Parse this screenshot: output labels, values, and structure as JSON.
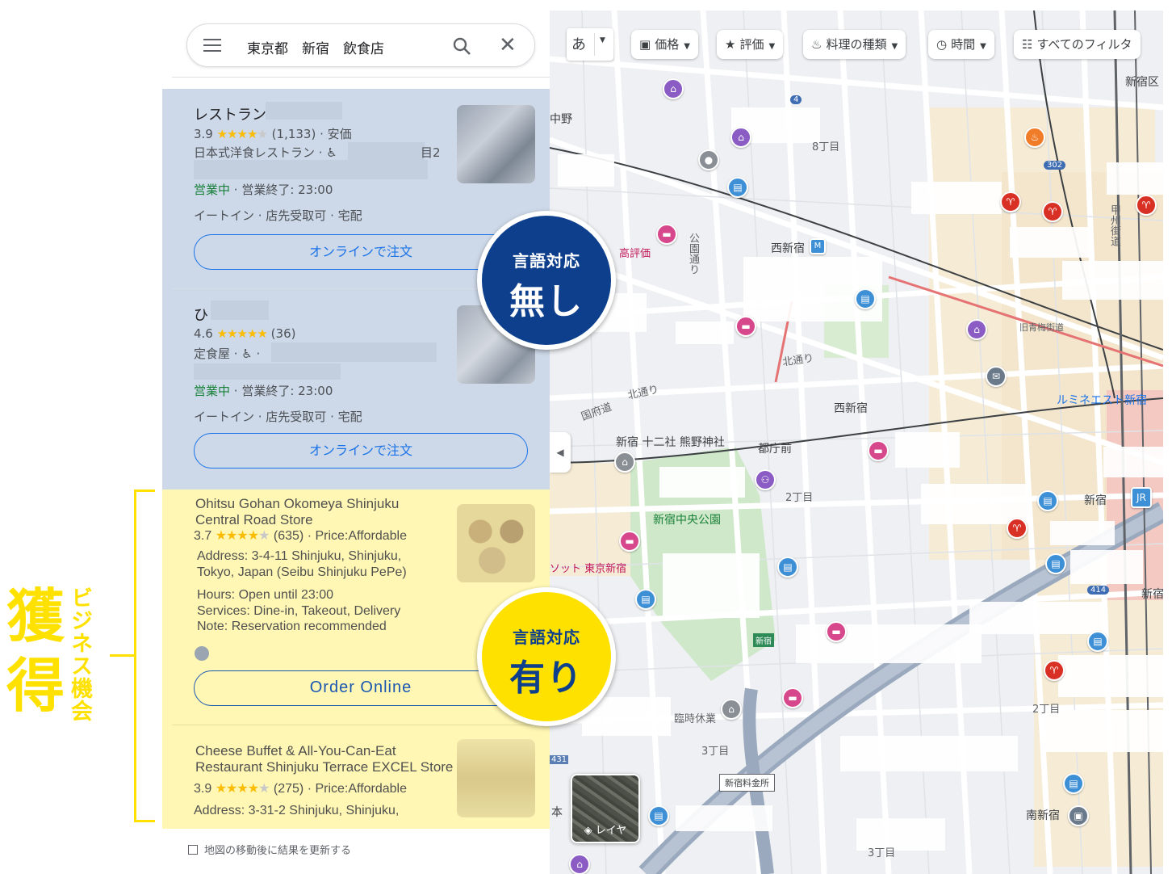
{
  "annotation": {
    "big_label": "獲得",
    "vertical_label": "ビジネス機会"
  },
  "search": {
    "query": "東京都　新宿　飲食店",
    "menu_icon": "hamburger-menu-icon",
    "search_icon": "magnifier-icon",
    "clear_icon": "close-icon"
  },
  "results_untranslated": [
    {
      "name": "レストラン",
      "rating": "3.9",
      "stars": "★★★★",
      "star_empty": "★",
      "reviews": "(1,133)",
      "price": "· 安価",
      "category": "日本式洋食レストラン · ♿",
      "address_tail": "目2",
      "status_open": "営業中",
      "status_rest": " · 営業終了: 23:00",
      "services": "イートイン · 店先受取可 · 宅配",
      "button": "オンラインで注文"
    },
    {
      "name": "ひ",
      "rating": "4.6",
      "stars": "★★★★★",
      "star_empty": "",
      "reviews": "(36)",
      "price": "",
      "category": "定食屋 · ♿ ·",
      "address_tail": "",
      "status_open": "営業中",
      "status_rest": " · 営業終了: 23:00",
      "services": "イートイン · 店先受取可 · 宅配",
      "button": "オンラインで注文"
    }
  ],
  "results_translated": [
    {
      "name_line1": "Ohitsu Gohan Okomeya Shinjuku",
      "name_line2": "Central Road Store",
      "rating": "3.7",
      "stars": "★★★★",
      "star_empty": "★",
      "reviews": "(635)",
      "price": "· Price:Affordable",
      "address_line1": "Address: 3-4-11 Shinjuku, Shinjuku,",
      "address_line2": "Tokyo, Japan (Seibu Shinjuku PePe)",
      "hours": "Hours: Open until 23:00",
      "services": "Services: Dine-in, Takeout, Delivery",
      "note": "Note: Reservation recommended",
      "button": "Order Online"
    },
    {
      "name_line1": "Cheese Buffet & All-You-Can-Eat",
      "name_line2": "Restaurant Shinjuku Terrace EXCEL Store",
      "rating": "3.9",
      "stars": "★★★★",
      "star_empty": "★",
      "reviews": "(275)",
      "price": "· Price:Affordable",
      "address_line1": "Address: 3-31-2 Shinjuku, Shinjuku,"
    }
  ],
  "footer": {
    "checkbox_label": "地図の移動後に結果を更新する"
  },
  "map": {
    "lang_chip": "あ",
    "chips": [
      "価格",
      "評価",
      "料理の種類",
      "時間",
      "すべてのフィルタ"
    ],
    "chip_icons": [
      "price-icon",
      "star-icon",
      "cuisine-icon",
      "clock-icon",
      "filter-sliders-icon"
    ],
    "labels": {
      "shinjuku_ku": "新宿区",
      "nakano": "中野",
      "chome8": "8丁目",
      "nishishinjuku_station": "西新宿",
      "high_rating": "高評価",
      "koen_dori": "公園通り",
      "kita_dori1": "北通り",
      "kita_dori2": "北通り",
      "kokufudo": "国府道",
      "juniso": "新宿 十二社 熊野神社",
      "tochomae": "都庁前",
      "nishishinjuku_area": "西新宿",
      "lumine": "ルミネエスト新宿",
      "shinjuku": "新宿",
      "chome2a": "2丁目",
      "chuo_koen": "新宿中央公園",
      "hilton": "ソット 東京新宿",
      "shinjuku_sign": "新宿",
      "rinji": "臨時休業",
      "chome3a": "3丁目",
      "toll": "新宿料金所",
      "layers": "レイヤ",
      "minami_shinjuku": "南新宿",
      "chome2b": "2丁目",
      "chome3b": "3丁目",
      "kyu_ome": "旧青梅街道",
      "route4": "4",
      "route302": "302",
      "route414": "414",
      "koshu": "甲州街道",
      "hon": "本",
      "num431": "431",
      "shinjuku_edge": "新宿"
    }
  },
  "badges": {
    "none_small": "言語対応",
    "none_big": "無し",
    "has_small": "言語対応",
    "has_big": "有り"
  },
  "colors": {
    "untranslated_bg": "#cdd8e8",
    "translated_bg": "#fff7b3",
    "accent_yellow": "#ffe100",
    "navy": "#0d3f8c",
    "link_blue": "#1a73e8"
  }
}
